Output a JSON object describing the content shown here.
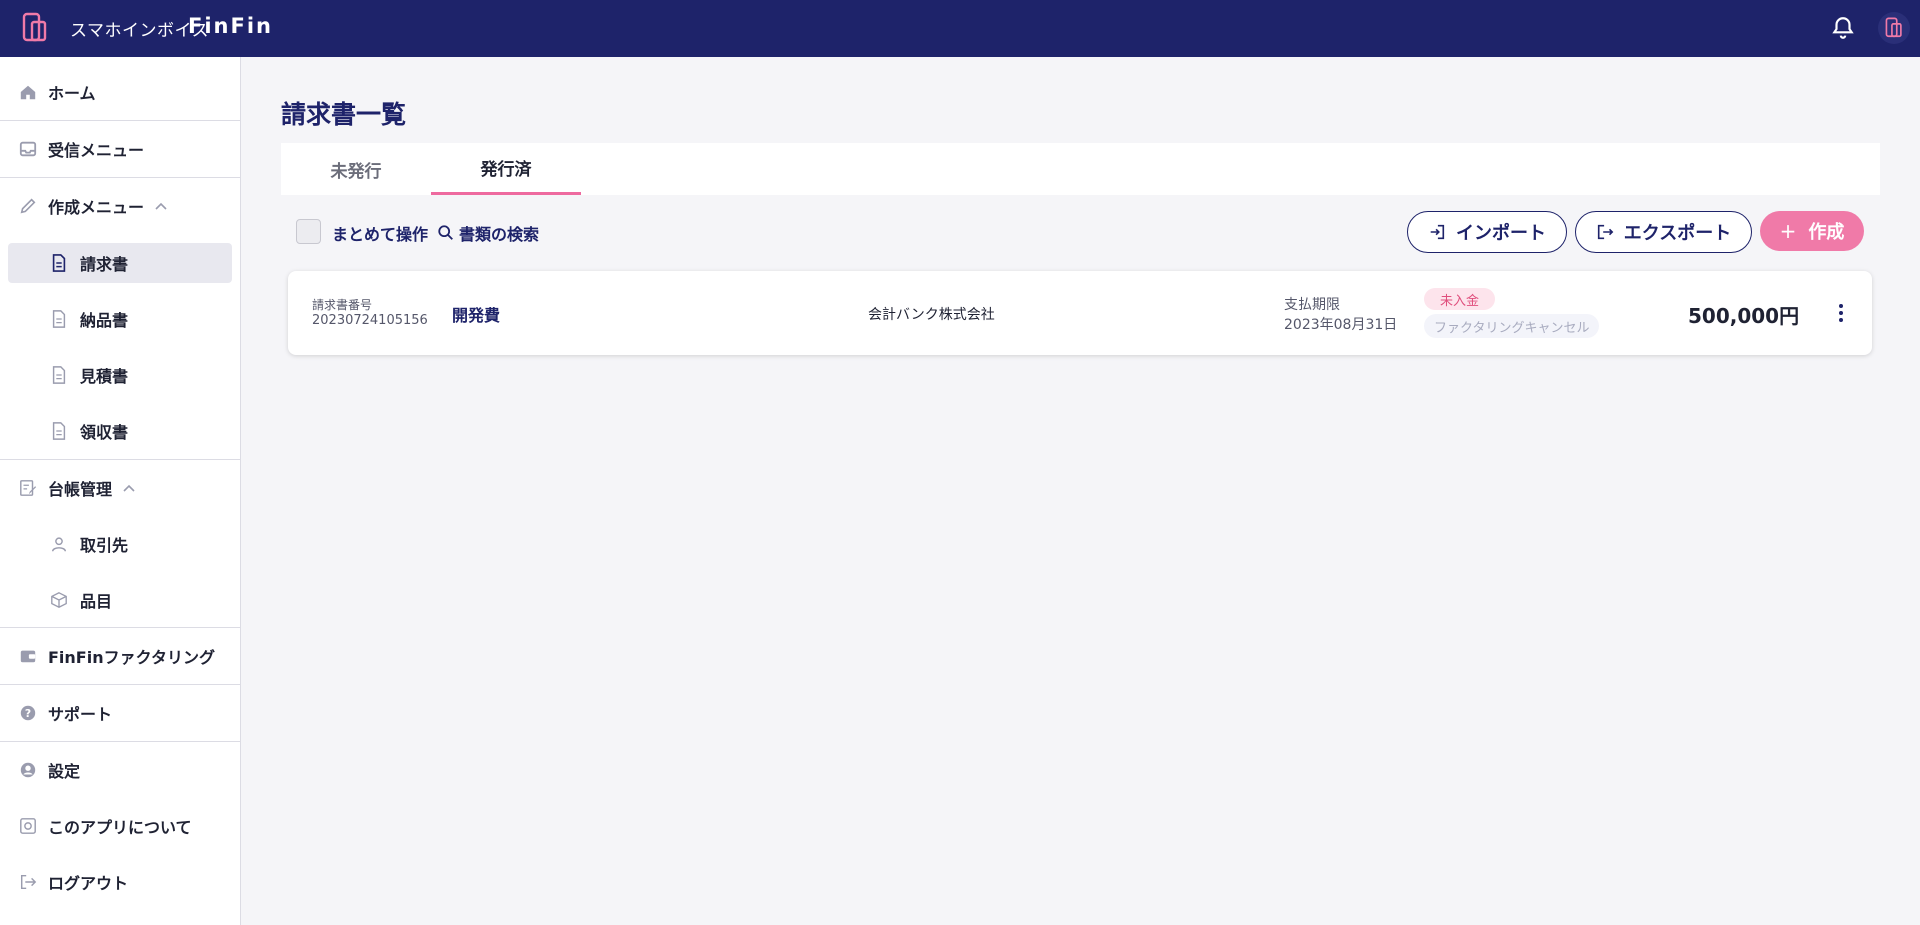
{
  "header": {
    "brand": "スマホインボイス",
    "brand_sub": "FinFin"
  },
  "sidebar": {
    "home": "ホーム",
    "inbox": "受信メニュー",
    "create_menu": "作成メニュー",
    "create_items": [
      "請求書",
      "納品書",
      "見積書",
      "領収書"
    ],
    "ledger": "台帳管理",
    "ledger_items": [
      "取引先",
      "品目"
    ],
    "factoring": "FinFinファクタリング",
    "support": "サポート",
    "settings": "設定",
    "about": "このアプリについて",
    "logout": "ログアウト"
  },
  "main": {
    "title": "請求書一覧",
    "tabs": [
      "未発行",
      "発行済"
    ],
    "active_tab": "発行済",
    "bulk_label": "まとめて操作",
    "search_label": "書類の検索",
    "import_label": "インポート",
    "export_label": "エクスポート",
    "create_label": "作成"
  },
  "invoices": [
    {
      "number_label": "請求書番号",
      "number": "20230724105156",
      "title": "開発費",
      "client": "会計バンク株式会社",
      "due_label": "支払期限",
      "due_date": "2023年08月31日",
      "status": "未入金",
      "factoring_status": "ファクタリングキャンセル",
      "amount": "500,000円"
    }
  ],
  "colors": {
    "header_bg": "#1e236a",
    "accent_pink": "#f07aa8",
    "primary_navy": "#1e236a"
  }
}
